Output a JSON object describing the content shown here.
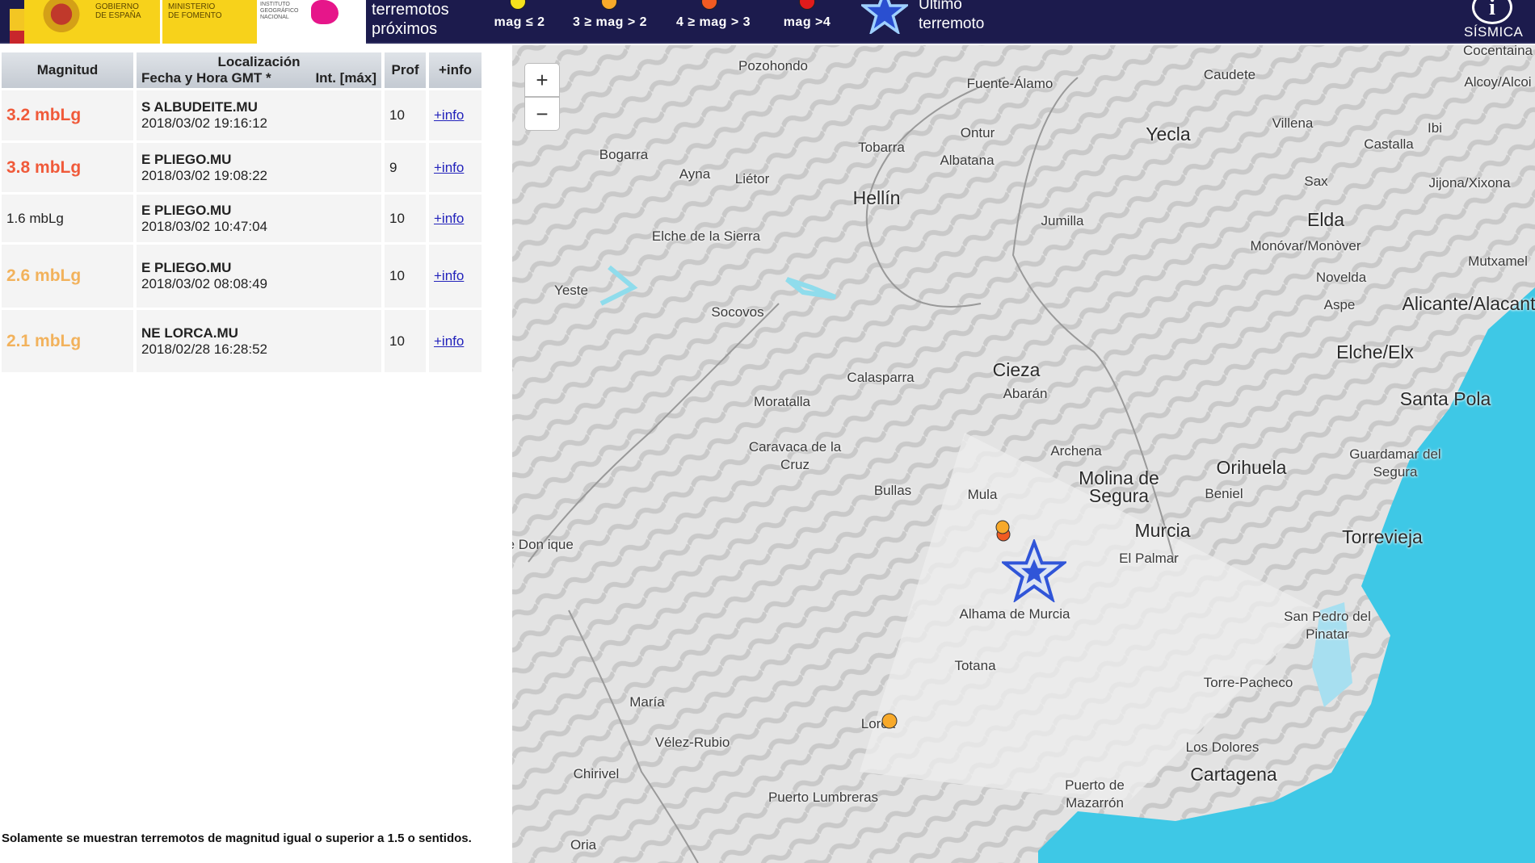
{
  "header": {
    "gov_line1": "Gobierno",
    "gov_line2": "de España",
    "min_line1": "Ministerio",
    "min_line2": "de Fomento",
    "ign_text": "Instituto Geográfico Nacional",
    "legend_title_1": "terremotos",
    "legend_title_2": "próximos",
    "legend": [
      {
        "label": "mag ≤ 2",
        "color": "#f5e11c"
      },
      {
        "label": "3 ≥ mag > 2",
        "color": "#f7a92a"
      },
      {
        "label": "4 ≥ mag > 3",
        "color": "#f05a22"
      },
      {
        "label": "mag >4",
        "color": "#e01b1b"
      }
    ],
    "last_quake_1": "Último",
    "last_quake_2": "terremoto",
    "info_icon": "i",
    "brand": "SÍSMICA"
  },
  "table": {
    "headers": {
      "magnitud": "Magnitud",
      "localizacion": "Localización",
      "fecha": "Fecha y Hora GMT *",
      "intensidad": "Int. [máx]",
      "prof": "Prof",
      "info": "+info"
    },
    "rows": [
      {
        "mag": "3.2 mbLg",
        "color": "#f05a3a",
        "place": "S ALBUDEITE.MU",
        "date": "2018/03/02 19:16:12",
        "prof": "10",
        "info": "+info"
      },
      {
        "mag": "3.8 mbLg",
        "color": "#f05a3a",
        "place": "E PLIEGO.MU",
        "date": "2018/03/02 19:08:22",
        "prof": "9",
        "info": "+info"
      },
      {
        "mag": "1.6 mbLg",
        "color": "#222222",
        "place": "E PLIEGO.MU",
        "date": "2018/03/02 10:47:04",
        "prof": "10",
        "info": "+info"
      },
      {
        "mag": "2.6 mbLg",
        "color": "#f2b25c",
        "place": "E PLIEGO.MU",
        "date": "2018/03/02 08:08:49",
        "prof": "10",
        "info": "+info"
      },
      {
        "mag": "2.1 mbLg",
        "color": "#f2b25c",
        "place": "NE LORCA.MU",
        "date": "2018/02/28 16:28:52",
        "prof": "10",
        "info": "+info"
      }
    ]
  },
  "note": "Solamente se muestran terremotos de magnitud igual o superior a 1.5 o sentidos.",
  "map": {
    "zoom_in": "+",
    "zoom_out": "−",
    "sea_color": "#3ec8e6",
    "labels": [
      "Pozohondo",
      "Fuente-Álamo",
      "Caudete",
      "Cocentaina",
      "Alcoy/Alcoi",
      "Ontur",
      "Yecla",
      "Villena",
      "Ibi",
      "Tobarra",
      "Albatana",
      "Castalla",
      "Bogarra",
      "Ayna",
      "Liétor",
      "Hellín",
      "Sax",
      "Jijona/Xixona",
      "Jumilla",
      "Elda",
      "Elche de la Sierra",
      "Monóvar/Monòver",
      "Mutxamel",
      "Yeste",
      "Novelda",
      "Aspe",
      "Alicante/Alacant",
      "Socovos",
      "Cieza",
      "Elche/Elx",
      "Calasparra",
      "Abarán",
      "Santa Pola",
      "Moratalla",
      "Caravaca de la Cruz",
      "Archena",
      "Guardamar del Segura",
      "Orihuela",
      "Molina de Segura",
      "Bullas",
      "Mula",
      "Beniel",
      "Murcia",
      "Torrevieja",
      "de Don ique",
      "El Palmar",
      "Alhama de Murcia",
      "San Pedro del Pinatar",
      "Totana",
      "Torre-Pacheco",
      "María",
      "Lorca",
      "Vélez-Rubio",
      "Los Dolores",
      "Chirivel",
      "Cartagena",
      "Puerto de Mazarrón",
      "Puerto Lumbreras",
      "Oria"
    ]
  }
}
